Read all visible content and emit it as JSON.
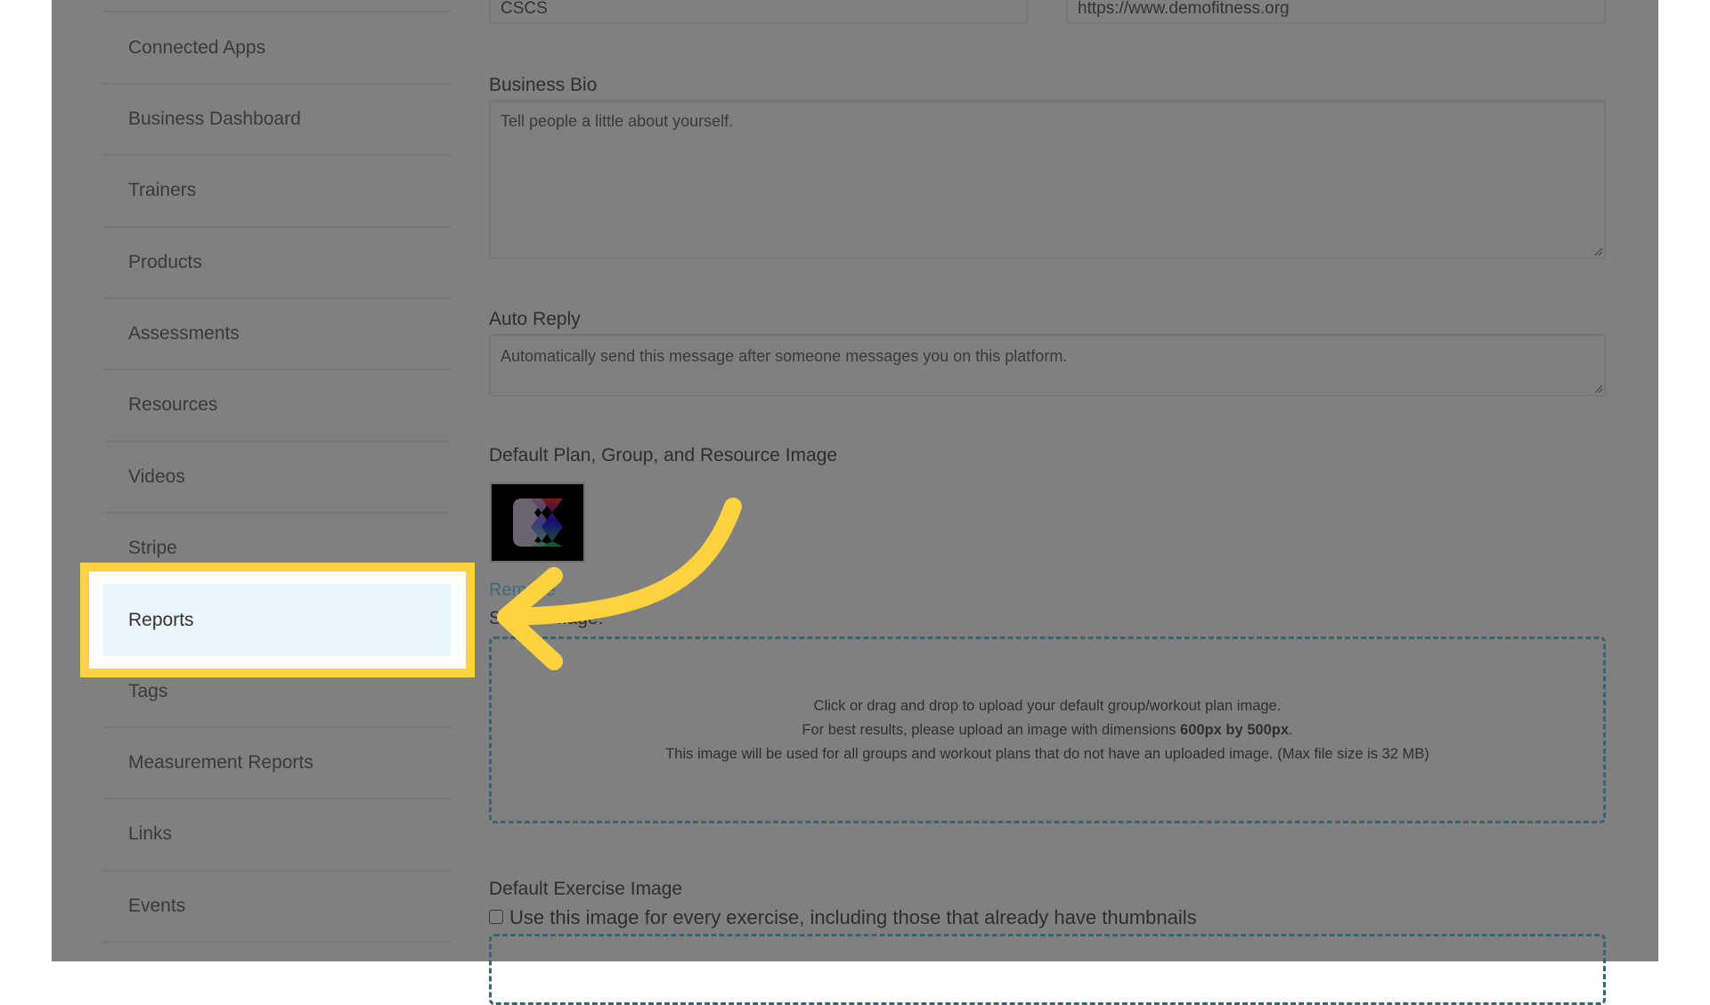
{
  "sidebar": {
    "items": [
      {
        "label": "Connected Apps"
      },
      {
        "label": "Business Dashboard"
      },
      {
        "label": "Trainers"
      },
      {
        "label": "Products"
      },
      {
        "label": "Assessments"
      },
      {
        "label": "Resources"
      },
      {
        "label": "Videos"
      },
      {
        "label": "Stripe"
      },
      {
        "label": "Reports",
        "highlighted": true
      },
      {
        "label": "Tags"
      },
      {
        "label": "Measurement Reports"
      },
      {
        "label": "Links"
      },
      {
        "label": "Events"
      }
    ]
  },
  "form": {
    "credentials_value": "CSCS",
    "website_value": "https://www.demofitness.org",
    "business_bio": {
      "label": "Business Bio",
      "placeholder": "Tell people a little about yourself."
    },
    "auto_reply": {
      "label": "Auto Reply",
      "placeholder": "Automatically send this message after someone messages you on this platform."
    },
    "default_image": {
      "label": "Default Plan, Group, and Resource Image",
      "thumbnail_icon": "brand-logo-icon",
      "remove_link": "Remove",
      "select_label": "Select Image:",
      "dropzone": {
        "line1": "Click or drag and drop to upload your default group/workout plan image.",
        "line2_prefix": "For best results, please upload an image with dimensions ",
        "line2_bold": "600px by 500px",
        "line2_suffix": ".",
        "line3": "This image will be used for all groups and workout plans that do not have an uploaded image. (Max file size is 32 MB)"
      }
    },
    "default_exercise_image": {
      "label": "Default Exercise Image",
      "checkbox_label": "Use this image for every exercise, including those that already have thumbnails",
      "checked": false
    }
  },
  "annotation": {
    "highlight_color": "#FFD23F",
    "target": "Reports"
  },
  "colors": {
    "overlay_gray": "#808080",
    "link_teal": "#3c6c79",
    "highlight_bg": "#e9f6fb"
  }
}
